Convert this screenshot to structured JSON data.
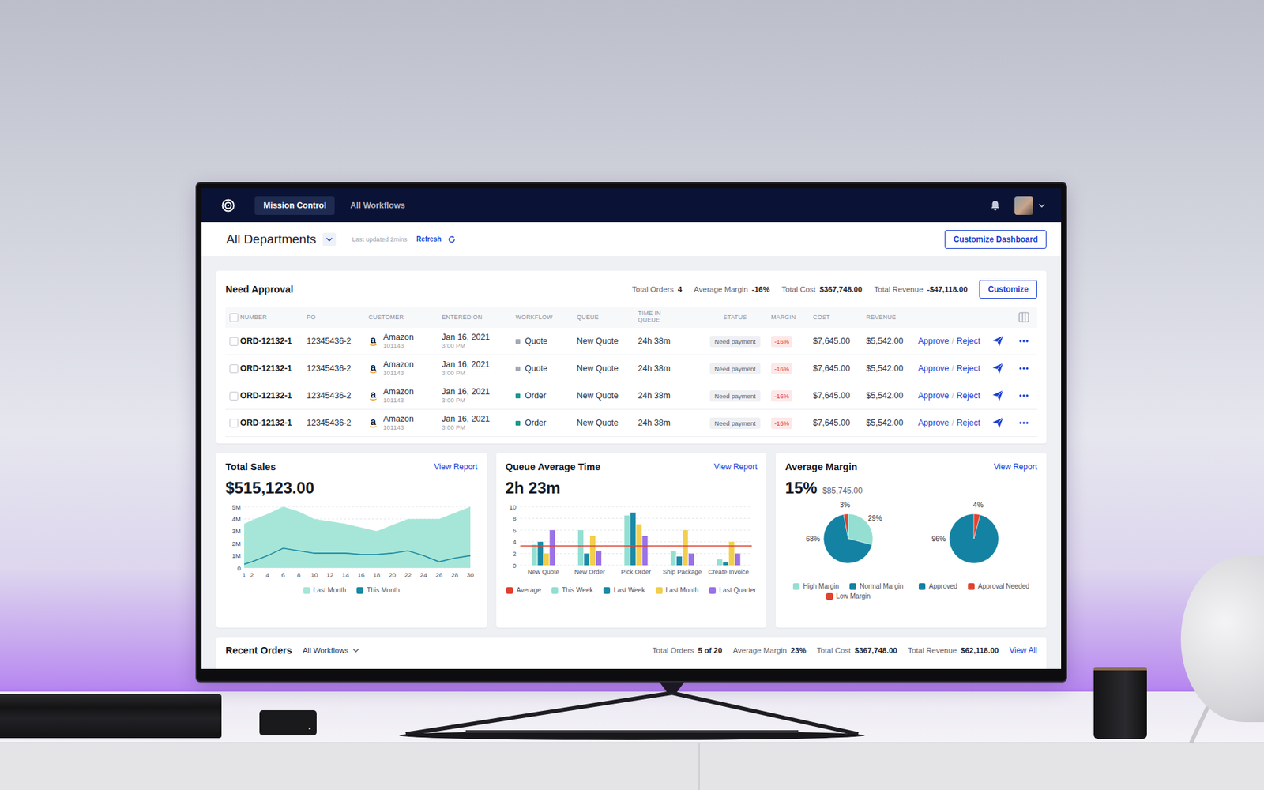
{
  "nav": {
    "tabs": [
      {
        "label": "Mission Control",
        "selected": true
      },
      {
        "label": "All Workflows",
        "selected": false
      }
    ]
  },
  "header": {
    "title": "All Departments",
    "updated": "Last updated 2mins",
    "refresh": "Refresh",
    "customize": "Customize Dashboard"
  },
  "approval": {
    "title": "Need Approval",
    "stats": [
      {
        "label": "Total Orders",
        "value": "4"
      },
      {
        "label": "Average Margin",
        "value": "-16%"
      },
      {
        "label": "Total Cost",
        "value": "$367,748.00"
      },
      {
        "label": "Total Revenue",
        "value": "-$47,118.00"
      }
    ],
    "customize": "Customize",
    "select_all": {
      "checked": false
    },
    "columns": [
      "NUMBER",
      "PO",
      "CUSTOMER",
      "ENTERED ON",
      "WORKFLOW",
      "QUEUE",
      "TIME IN QUEUE",
      "STATUS",
      "MARGIN",
      "COST",
      "REVENUE"
    ],
    "rows": [
      {
        "checked": false,
        "number": "ORD-12132-1",
        "po": "12345436-2",
        "logo": "a",
        "customer": "Amazon",
        "customer_id": "101143",
        "date": "Jan 16, 2021",
        "time": "3:00 PM",
        "workflow": "Quote",
        "workflow_color": "#a3aab3",
        "queue": "New Quote",
        "time_in_queue": "24h 38m",
        "status": "Need payment",
        "margin": "-16%",
        "cost": "$7,645.00",
        "revenue": "$5,542.00",
        "approve": "Approve",
        "separator": "/",
        "reject": "Reject"
      },
      {
        "checked": false,
        "number": "ORD-12132-1",
        "po": "12345436-2",
        "logo": "a",
        "customer": "Amazon",
        "customer_id": "101143",
        "date": "Jan 16, 2021",
        "time": "3:00 PM",
        "workflow": "Quote",
        "workflow_color": "#a3aab3",
        "queue": "New Quote",
        "time_in_queue": "24h 38m",
        "status": "Need payment",
        "margin": "-16%",
        "cost": "$7,645.00",
        "revenue": "$5,542.00",
        "approve": "Approve",
        "separator": "/",
        "reject": "Reject"
      },
      {
        "checked": false,
        "number": "ORD-12132-1",
        "po": "12345436-2",
        "logo": "a",
        "customer": "Amazon",
        "customer_id": "101143",
        "date": "Jan 16, 2021",
        "time": "3:00 PM",
        "workflow": "Order",
        "workflow_color": "#1c9a8e",
        "queue": "New Quote",
        "time_in_queue": "24h 38m",
        "status": "Need payment",
        "margin": "-16%",
        "cost": "$7,645.00",
        "revenue": "$5,542.00",
        "approve": "Approve",
        "separator": "/",
        "reject": "Reject"
      },
      {
        "checked": false,
        "number": "ORD-12132-1",
        "po": "12345436-2",
        "logo": "a",
        "customer": "Amazon",
        "customer_id": "101143",
        "date": "Jan 16, 2021",
        "time": "3:00 PM",
        "workflow": "Order",
        "workflow_color": "#1c9a8e",
        "queue": "New Quote",
        "time_in_queue": "24h 38m",
        "status": "Need payment",
        "margin": "-16%",
        "cost": "$7,645.00",
        "revenue": "$5,542.00",
        "approve": "Approve",
        "separator": "/",
        "reject": "Reject"
      }
    ]
  },
  "total_sales": {
    "title": "Total Sales",
    "link": "View Report",
    "value": "$515,123.00",
    "y_max": 5000000,
    "y_ticks": [
      "5M",
      "4M",
      "3M",
      "2M",
      "1M",
      "0"
    ],
    "x_ticks": [
      "1",
      "2",
      "4",
      "6",
      "8",
      "10",
      "12",
      "14",
      "16",
      "18",
      "20",
      "22",
      "24",
      "26",
      "28",
      "30"
    ],
    "days": [
      1,
      2,
      4,
      6,
      8,
      10,
      12,
      14,
      16,
      18,
      20,
      22,
      24,
      26,
      28,
      30
    ],
    "series": [
      {
        "name": "Last Month",
        "kind": "area",
        "color": "#a6e6d8",
        "values": [
          3600000,
          3900000,
          4400000,
          5000000,
          4600000,
          4000000,
          3800000,
          3600000,
          3300000,
          3000000,
          3500000,
          4000000,
          4000000,
          4000000,
          4500000,
          5000000
        ]
      },
      {
        "name": "This Month",
        "kind": "line",
        "color": "#1b8aa3",
        "values": [
          300000,
          500000,
          1000000,
          1600000,
          1400000,
          1200000,
          1200000,
          1200000,
          1100000,
          1100000,
          1200000,
          1400000,
          1000000,
          500000,
          800000,
          1000000
        ]
      }
    ]
  },
  "queue_time": {
    "title": "Queue Average Time",
    "link": "View Report",
    "value": "2h 23m",
    "y_max": 10,
    "y_ticks": [
      "10",
      "8",
      "6",
      "4",
      "2",
      "0"
    ],
    "categories": [
      "New Quote",
      "New Order",
      "Pick Order",
      "Ship Package",
      "Create Invoice"
    ],
    "series": [
      {
        "name": "Average",
        "kind": "line",
        "color": "#e0412f",
        "values": [
          3.3,
          3.3,
          3.3,
          3.3,
          3.3
        ]
      },
      {
        "name": "This Week",
        "kind": "bar",
        "color": "#94dfd2",
        "values": [
          3.5,
          6,
          8.5,
          2.5,
          1
        ]
      },
      {
        "name": "Last Week",
        "kind": "bar",
        "color": "#1a8aa6",
        "values": [
          4,
          2,
          9,
          1.5,
          0.5
        ]
      },
      {
        "name": "Last Month",
        "kind": "bar",
        "color": "#f2cf4c",
        "values": [
          2,
          5,
          7,
          6,
          4
        ]
      },
      {
        "name": "Last Quarter",
        "kind": "bar",
        "color": "#9b72e6",
        "values": [
          6,
          2.5,
          5,
          2,
          2
        ]
      }
    ]
  },
  "average_margin": {
    "title": "Average Margin",
    "link": "View Report",
    "value": "15%",
    "amount": "$85,745.00",
    "pies": [
      {
        "slices": [
          {
            "name": "High Margin",
            "value": 29,
            "label": "29%",
            "color": "#94dfd2"
          },
          {
            "name": "Normal Margin",
            "value": 68,
            "label": "68%",
            "color": "#1482a3"
          },
          {
            "name": "Low Margin",
            "value": 3,
            "label": "3%",
            "color": "#e0442f"
          }
        ]
      },
      {
        "slices": [
          {
            "name": "Approved",
            "value": 96,
            "label": "96%",
            "color": "#1482a3"
          },
          {
            "name": "Approval Needed",
            "value": 4,
            "label": "4%",
            "color": "#e0442f"
          }
        ]
      }
    ]
  },
  "recent": {
    "title": "Recent Orders",
    "filter": "All Workflows",
    "stats": [
      {
        "label": "Total Orders",
        "value": "5 of 20"
      },
      {
        "label": "Average Margin",
        "value": "23%"
      },
      {
        "label": "Total Cost",
        "value": "$367,748.00"
      },
      {
        "label": "Total Revenue",
        "value": "$62,118.00"
      }
    ],
    "link": "View All"
  }
}
